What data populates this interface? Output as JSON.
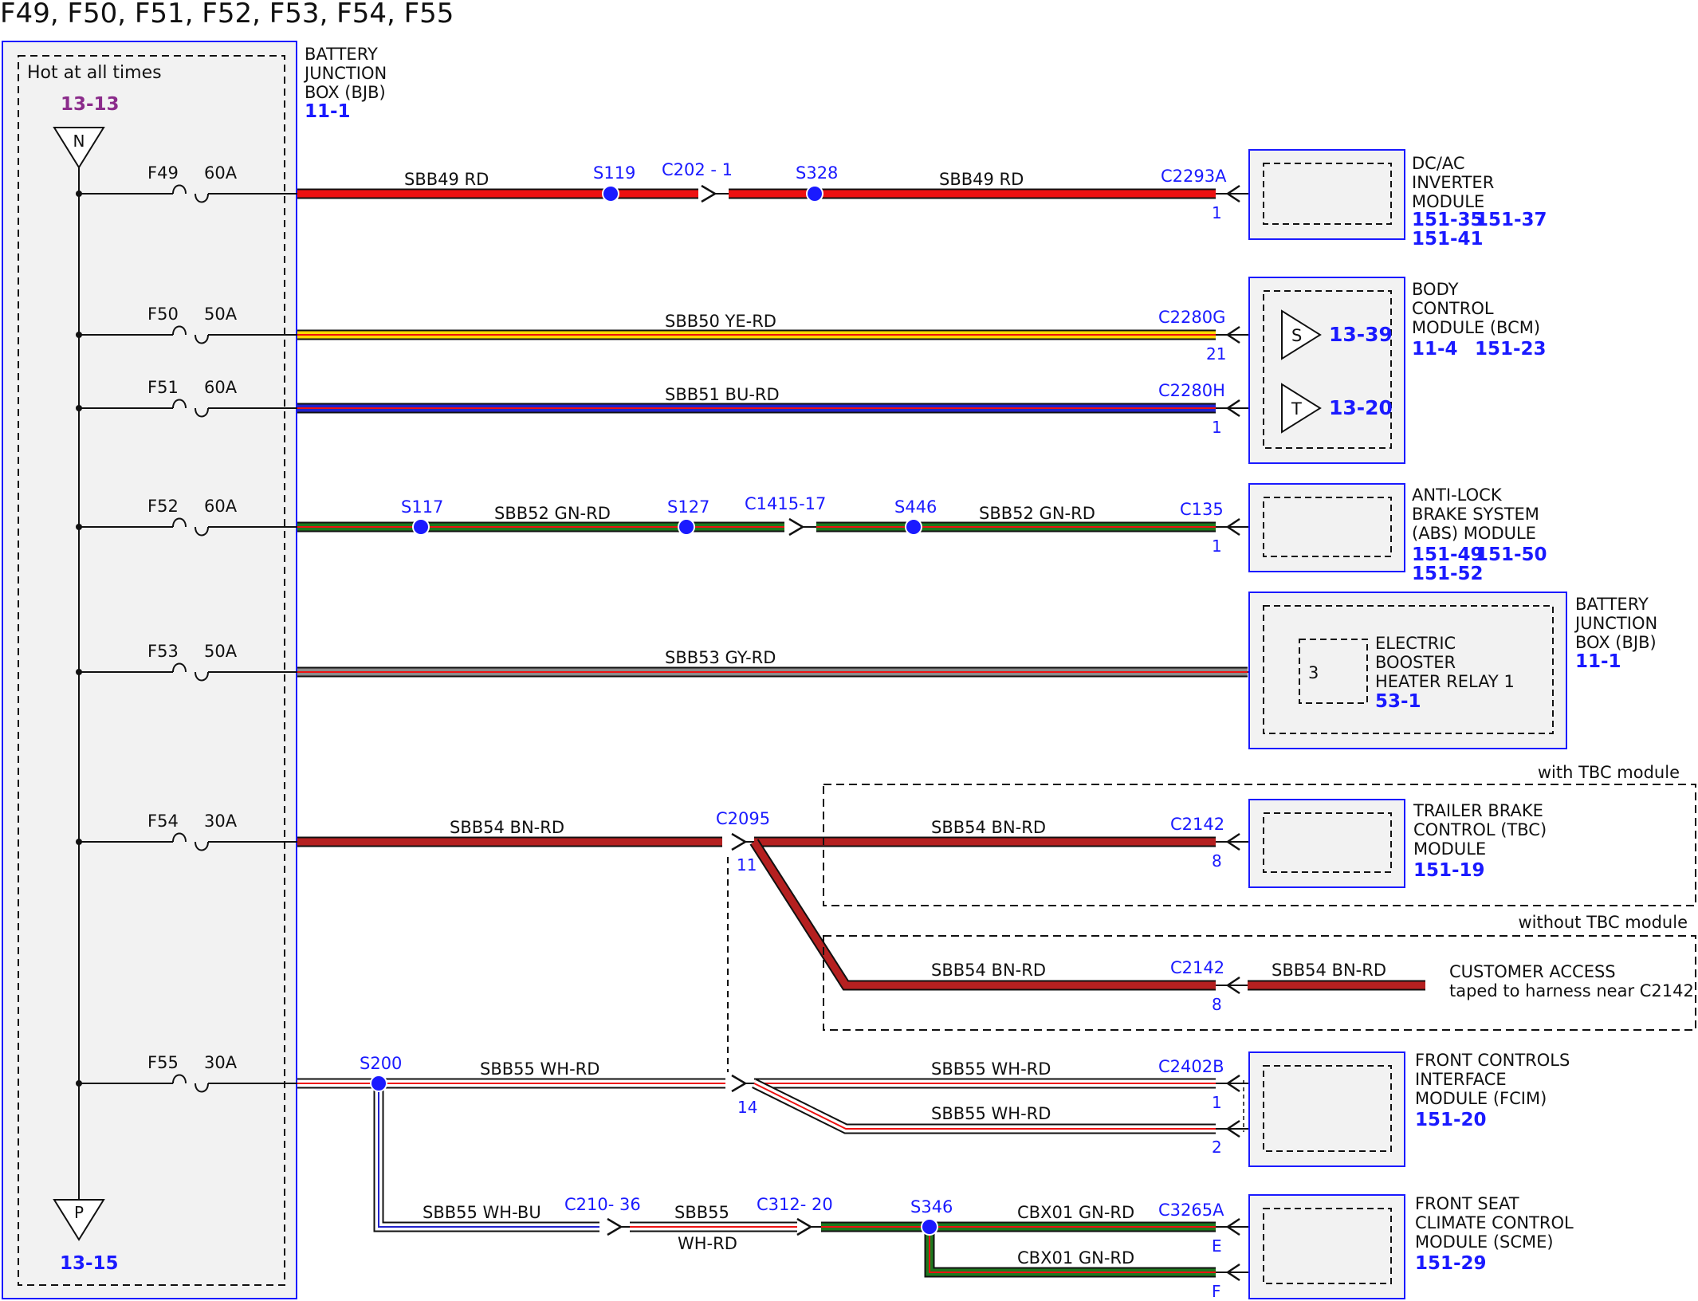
{
  "title": "F49, F50, F51, F52, F53, F54, F55",
  "colors": {
    "blue_ref": "#1a1aff",
    "purple_ref": "#8b2c8b",
    "module_box_border": "#1a1aff",
    "RD": "#ee1111",
    "YE": "#ffd800",
    "BU": "#2222cc",
    "GN": "#1e7a1e",
    "GY": "#8c8c8c",
    "BN": "#b52020",
    "WH": "#ffffff"
  },
  "left_box": {
    "hot_label": "Hot at all times",
    "top_ref": "13-13",
    "top_symbol": "N",
    "bottom_symbol": "P",
    "bottom_ref": "13-15",
    "bjb_name": [
      "BATTERY",
      "JUNCTION",
      "BOX (BJB)"
    ],
    "bjb_ref": "11-1"
  },
  "fuses": [
    {
      "id": "F49",
      "rating": "60A"
    },
    {
      "id": "F50",
      "rating": "50A"
    },
    {
      "id": "F51",
      "rating": "60A"
    },
    {
      "id": "F52",
      "rating": "60A"
    },
    {
      "id": "F53",
      "rating": "50A"
    },
    {
      "id": "F54",
      "rating": "30A"
    },
    {
      "id": "F55",
      "rating": "30A"
    }
  ],
  "circuits": {
    "f49": {
      "wire_a": "SBB49  RD",
      "wire_b": "SBB49  RD",
      "splice_1": "S119",
      "inline": "C202 - 1",
      "splice_2": "S328",
      "connector": "C2293A",
      "pin": "1"
    },
    "f50": {
      "wire": "SBB50  YE-RD",
      "connector": "C2280G",
      "pin": "21"
    },
    "f51": {
      "wire": "SBB51  BU-RD",
      "connector": "C2280H",
      "pin": "1"
    },
    "f52": {
      "wire_a": "SBB52  GN-RD",
      "wire_b": "SBB52  GN-RD",
      "splice_1": "S117",
      "splice_2": "S127",
      "inline": "C1415-17",
      "splice_3": "S446",
      "connector": "C135",
      "pin": "1"
    },
    "f53": {
      "wire": "SBB53  GY-RD",
      "pin": "3"
    },
    "f54": {
      "wire_a": "SBB54  BN-RD",
      "inline": "C2095",
      "inline_pin": "11",
      "wire_tbc": "SBB54  BN-RD",
      "connector_tbc": "C2142",
      "pin_tbc": "8",
      "with_tbc": "with TBC module",
      "without_tbc": "without TBC module",
      "wire_notbc": "SBB54  BN-RD",
      "connector_notbc": "C2142",
      "pin_notbc": "8",
      "wire_access": "SBB54  BN-RD",
      "access_label": [
        "CUSTOMER ACCESS",
        "taped to harness near C2142"
      ]
    },
    "f55": {
      "splice": "S200",
      "wire_a": "SBB55  WH-RD",
      "inline_pin": "14",
      "wire_b1": "SBB55  WH-RD",
      "wire_b2": "SBB55  WH-RD",
      "connector": "C2402B",
      "pin_1": "1",
      "pin_2": "2",
      "wire_bu": "SBB55  WH-BU",
      "inline_c210": "C210- 36",
      "wire_c_top": "SBB55",
      "wire_c_bot": "WH-RD",
      "inline_c312": "C312- 20",
      "splice_s346": "S346",
      "wire_cbx_1": "CBX01  GN-RD",
      "wire_cbx_2": "CBX01  GN-RD",
      "connector_scme": "C3265A",
      "pin_e": "E",
      "pin_f": "F"
    }
  },
  "modules": {
    "inverter": {
      "name": [
        "DC/AC",
        "INVERTER",
        "MODULE"
      ],
      "refs": [
        "151-35",
        "151-37",
        "151-41"
      ]
    },
    "bcm": {
      "name": [
        "BODY",
        "CONTROL",
        "MODULE (BCM)"
      ],
      "refs": [
        "11-4",
        "151-23"
      ],
      "sym_s": "S",
      "ref_s": "13-39",
      "sym_t": "T",
      "ref_t": "13-20"
    },
    "abs": {
      "name": [
        "ANTI-LOCK",
        "BRAKE SYSTEM",
        "(ABS) MODULE"
      ],
      "refs": [
        "151-49",
        "151-50",
        "151-52"
      ]
    },
    "bjb2": {
      "name": [
        "BATTERY",
        "JUNCTION",
        "BOX (BJB)"
      ],
      "ref": "11-1",
      "relay_name": [
        "ELECTRIC",
        "BOOSTER",
        "HEATER RELAY 1"
      ],
      "relay_ref": "53-1"
    },
    "tbc": {
      "name": [
        "TRAILER BRAKE",
        "CONTROL (TBC)",
        "MODULE"
      ],
      "ref": "151-19"
    },
    "fcim": {
      "name": [
        "FRONT CONTROLS",
        "INTERFACE",
        "MODULE (FCIM)"
      ],
      "ref": "151-20"
    },
    "scme": {
      "name": [
        "FRONT SEAT",
        "CLIMATE CONTROL",
        "MODULE (SCME)"
      ],
      "ref": "151-29"
    }
  }
}
